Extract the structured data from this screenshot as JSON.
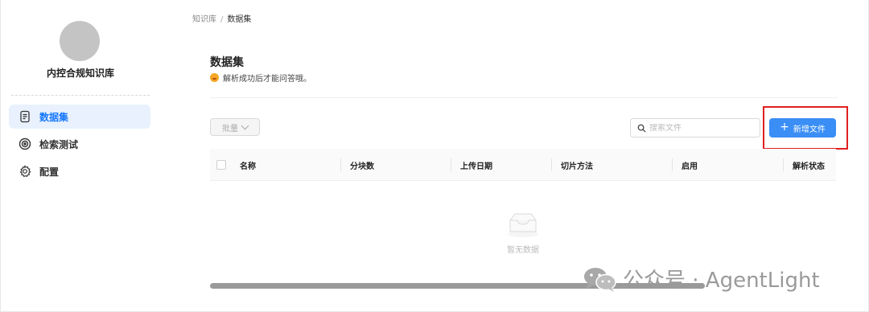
{
  "sidebar": {
    "kb_name": "内控合规知识库",
    "items": [
      {
        "label": "数据集",
        "icon": "document-icon",
        "active": true
      },
      {
        "label": "检索测试",
        "icon": "target-icon",
        "active": false
      },
      {
        "label": "配置",
        "icon": "gear-icon",
        "active": false
      }
    ]
  },
  "breadcrumb": {
    "root": "知识库",
    "separator": "/",
    "current": "数据集"
  },
  "header": {
    "title": "数据集",
    "subtitle": "解析成功后才能问答哦。"
  },
  "toolbar": {
    "batch_label": "批量",
    "search_placeholder": "搜索文件",
    "add_label": "新增文件"
  },
  "table": {
    "columns": [
      "名称",
      "分块数",
      "上传日期",
      "切片方法",
      "启用",
      "解析状态"
    ],
    "empty_text": "暂无数据",
    "horizontal_scroll": 0.79
  },
  "watermark": {
    "text": "公众号 · AgentLight"
  },
  "colors": {
    "accent": "#1677ff",
    "active_bg": "#e8f1fd",
    "primary_button": "#3a8ef6",
    "highlight": "#e02020"
  }
}
